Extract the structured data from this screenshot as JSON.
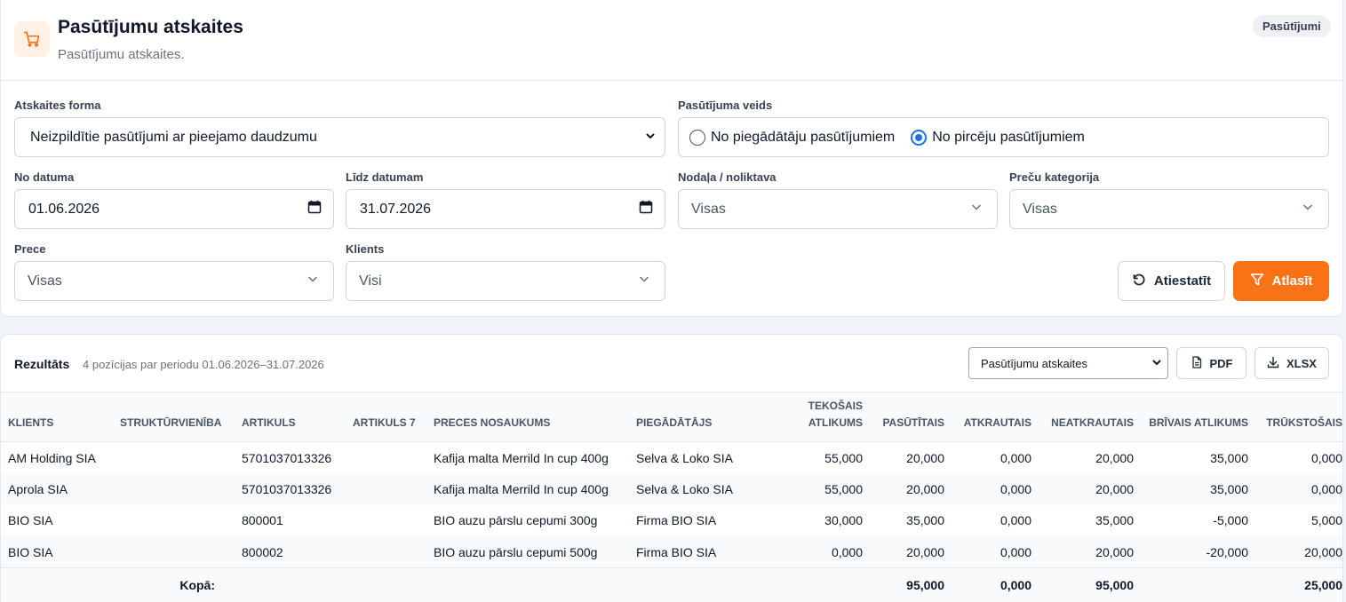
{
  "header": {
    "title": "Pasūtījumu atskaites",
    "subtitle": "Pasūtījumu atskaites.",
    "badge": "Pasūtījumi",
    "icon": "cart-icon",
    "accent": "#f97316"
  },
  "filters": {
    "report_form": {
      "label": "Atskaites forma",
      "value": "Neizpildītie pasūtījumi ar pieejamo daudzumu"
    },
    "order_type": {
      "label": "Pasūtījuma veids",
      "options": [
        {
          "label": "No piegādātāju pasūtījumiem",
          "checked": false
        },
        {
          "label": "No pircēju pasūtījumiem",
          "checked": true
        }
      ]
    },
    "date_from": {
      "label": "No datuma",
      "value": "01.06.2026"
    },
    "date_to": {
      "label": "Līdz datumam",
      "value": "31.07.2026"
    },
    "department": {
      "label": "Nodaļa / noliktava",
      "value": "Visas"
    },
    "category": {
      "label": "Preču kategorija",
      "value": "Visas"
    },
    "product": {
      "label": "Prece",
      "value": "Visas"
    },
    "client": {
      "label": "Klients",
      "value": "Visi"
    },
    "reset_label": "Atiestatīt",
    "submit_label": "Atlasīt"
  },
  "results": {
    "title": "Rezultāts",
    "summary": "4 pozīcijas par periodu 01.06.2026–31.07.2026",
    "view_select": "Pasūtījumu atskaites",
    "pdf_label": "PDF",
    "xlsx_label": "XLSX",
    "columns": [
      {
        "label": "KLIENTS",
        "num": false
      },
      {
        "label": "STRUKTŪRVIENĪBA",
        "num": false
      },
      {
        "label": "ARTIKULS",
        "num": false
      },
      {
        "label": "ARTIKULS 7",
        "num": false
      },
      {
        "label": "PRECES NOSAUKUMS",
        "num": false
      },
      {
        "label": "PIEGĀDĀTĀJS",
        "num": false
      },
      {
        "label": "TEKOŠAIS ATLIKUMS",
        "num": true
      },
      {
        "label": "PASŪTĪTAIS",
        "num": true
      },
      {
        "label": "ATKRAUTAIS",
        "num": true
      },
      {
        "label": "NEATKRAUTAIS",
        "num": true
      },
      {
        "label": "BRĪVAIS ATLIKUMS",
        "num": true
      },
      {
        "label": "TRŪKSTOŠAIS",
        "num": true
      }
    ],
    "rows": [
      [
        "AM Holding SIA",
        "",
        "5701037013326",
        "",
        "Kafija malta Merrild In cup 400g",
        "Selva & Loko SIA",
        "55,000",
        "20,000",
        "0,000",
        "20,000",
        "35,000",
        "0,000"
      ],
      [
        "Aprola SIA",
        "",
        "5701037013326",
        "",
        "Kafija malta Merrild In cup 400g",
        "Selva & Loko SIA",
        "55,000",
        "20,000",
        "0,000",
        "20,000",
        "35,000",
        "0,000"
      ],
      [
        "BIO SIA",
        "",
        "800001",
        "",
        "BIO auzu pārslu cepumi 300g",
        "Firma BIO SIA",
        "30,000",
        "35,000",
        "0,000",
        "35,000",
        "-5,000",
        "5,000"
      ],
      [
        "BIO SIA",
        "",
        "800002",
        "",
        "BIO auzu pārslu cepumi 500g",
        "Firma BIO SIA",
        "0,000",
        "20,000",
        "0,000",
        "20,000",
        "-20,000",
        "20,000"
      ]
    ],
    "totals": {
      "label": "Kopā:",
      "ordered": "95,000",
      "unloaded": "0,000",
      "not_unloaded": "95,000",
      "missing": "25,000"
    }
  }
}
